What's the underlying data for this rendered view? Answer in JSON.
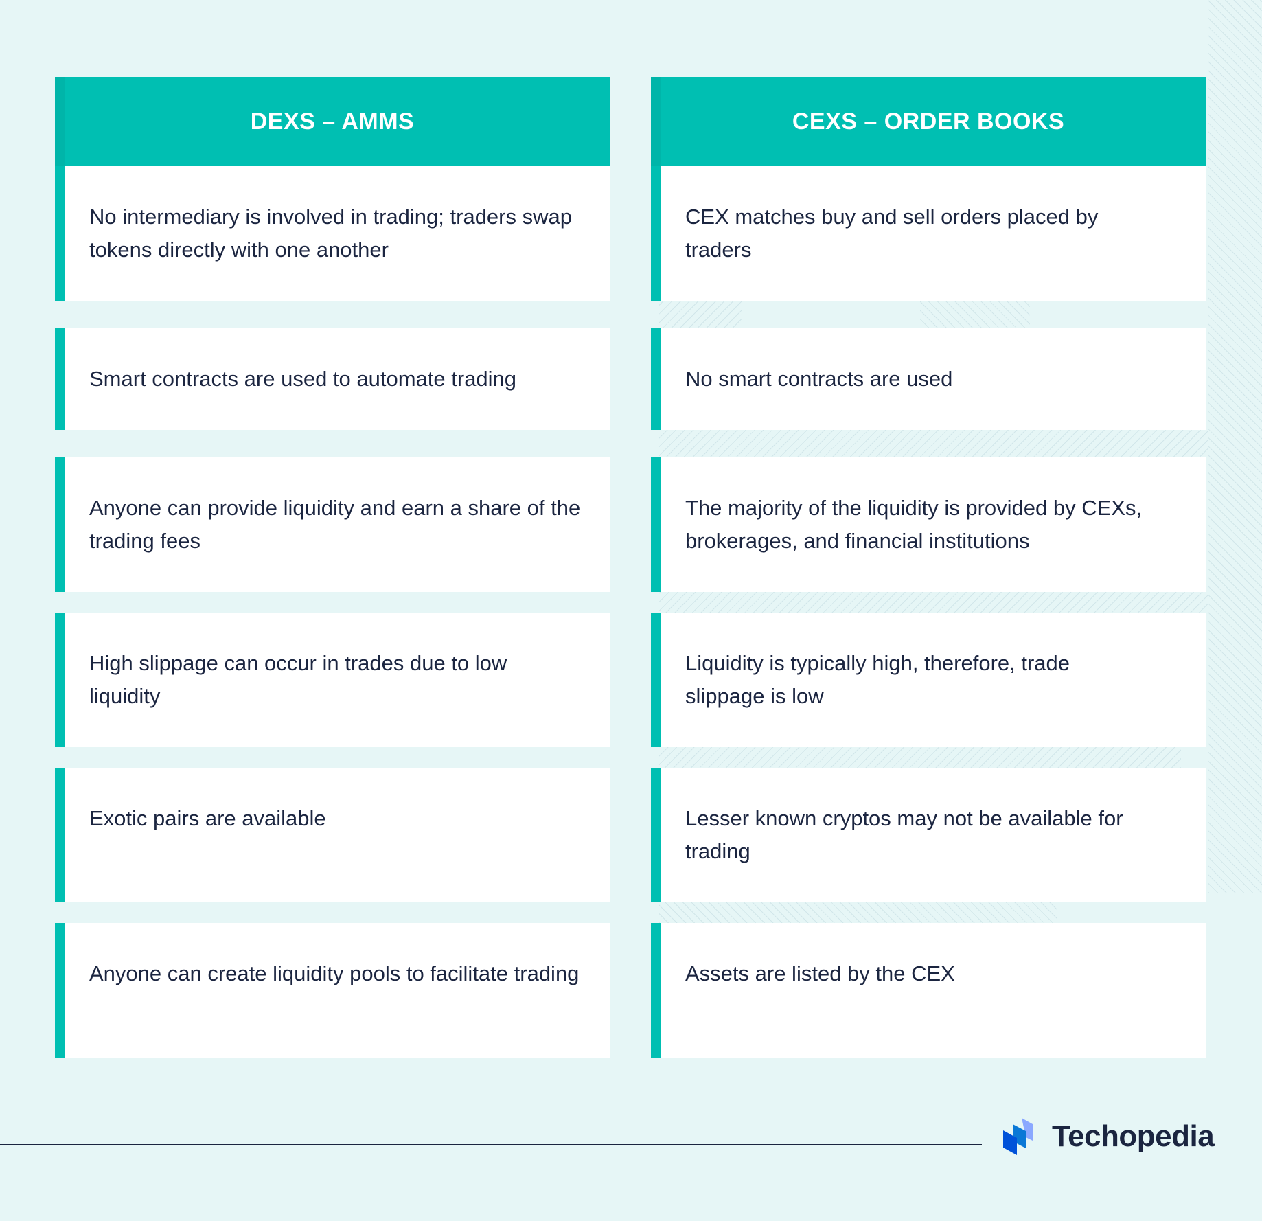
{
  "columns": [
    {
      "title": "DEXS – AMMS",
      "rows": [
        "No intermediary is involved in trading; traders swap tokens directly with one another",
        "Smart contracts are used to automate trading",
        "Anyone can provide liquidity and earn a share of the trading fees",
        "High slippage can occur in trades due to low liquidity",
        "Exotic pairs are available",
        "Anyone can create liquidity pools to facilitate trading"
      ]
    },
    {
      "title": "CEXS – ORDER BOOKS",
      "rows": [
        "CEX matches buy and sell orders placed by traders",
        "No smart contracts are used",
        "The majority of the liquidity is provided by CEXs, brokerages, and financial institutions",
        "Liquidity is typically high, therefore, trade slippage is low",
        "Lesser known cryptos may not be available for trading",
        "Assets are listed by the CEX"
      ]
    }
  ],
  "brand": {
    "name": "Techopedia",
    "icon": "techopedia-logo-icon",
    "colors": {
      "teal": "#00bfb2",
      "navy": "#1b2540",
      "background": "#e6f6f6",
      "logo_blue_dark": "#0052d9",
      "logo_blue_mid": "#0a78d6",
      "logo_blue_light": "#8aa8ff"
    }
  }
}
